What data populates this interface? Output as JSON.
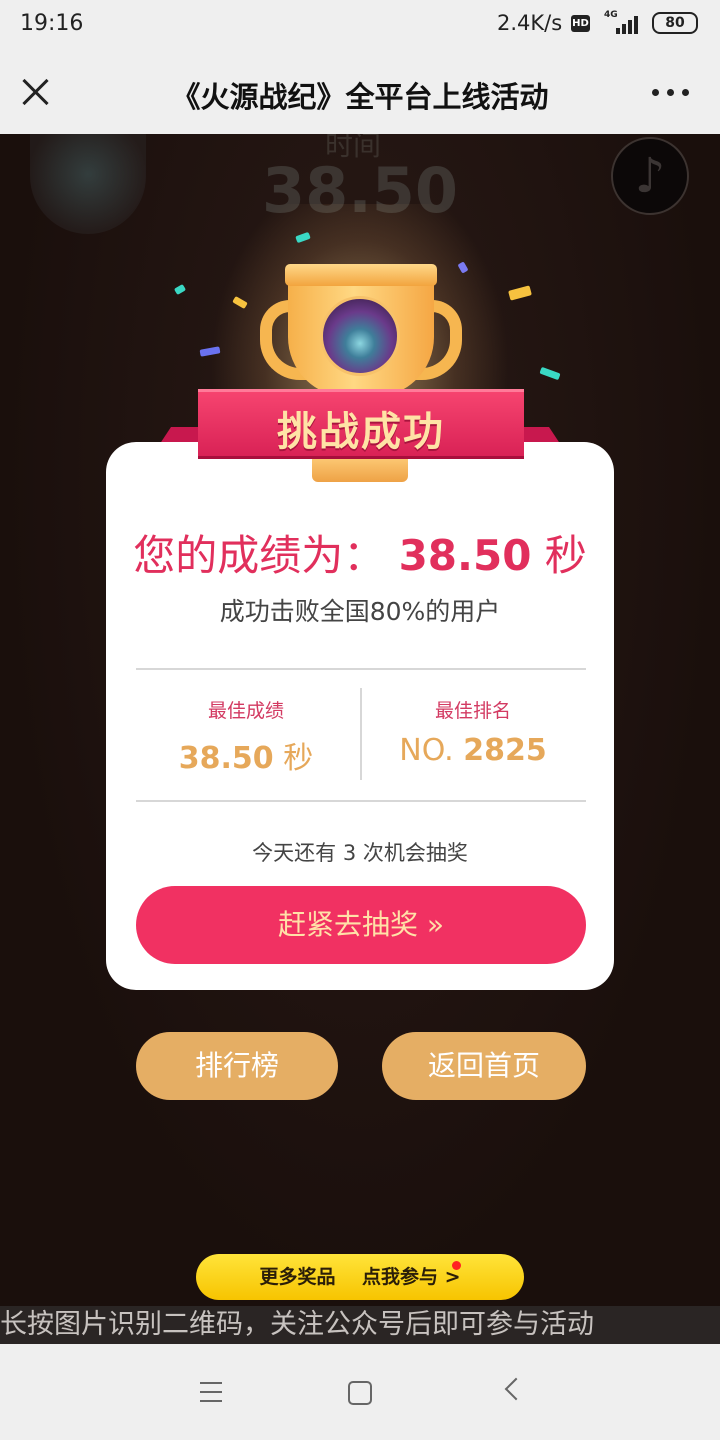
{
  "status_bar": {
    "time": "19:16",
    "speed": "2.4K/s",
    "hd": "HD",
    "network": "4G",
    "battery": "80"
  },
  "title_bar": {
    "title": "《火源战纪》全平台上线活动"
  },
  "background": {
    "time_label": "时间",
    "time_value": "38.50",
    "music_icon": "♪"
  },
  "banner": {
    "text": "挑战成功"
  },
  "result": {
    "score_prefix": "您的成绩为：",
    "score_value": "38.50",
    "score_unit": "秒",
    "beat_text": "成功击败全国80%的用户",
    "best_score_label": "最佳成绩",
    "best_score_value": "38.50",
    "best_score_unit": "秒",
    "best_rank_label": "最佳排名",
    "best_rank_prefix": "NO.",
    "best_rank_value": "2825",
    "chances_text": "今天还有 3 次机会抽奖",
    "draw_button": "赶紧去抽奖 »"
  },
  "actions": {
    "ranking": "排行榜",
    "home": "返回首页"
  },
  "more_prizes": {
    "left": "更多奖品",
    "right": "点我参与",
    "arrow": ">"
  },
  "hint": "长按图片识别二维码，关注公众号后即可参与活动",
  "colors": {
    "accent": "#f13162",
    "gold": "#e5ae64",
    "banner_yellow": "#ffe43a"
  }
}
